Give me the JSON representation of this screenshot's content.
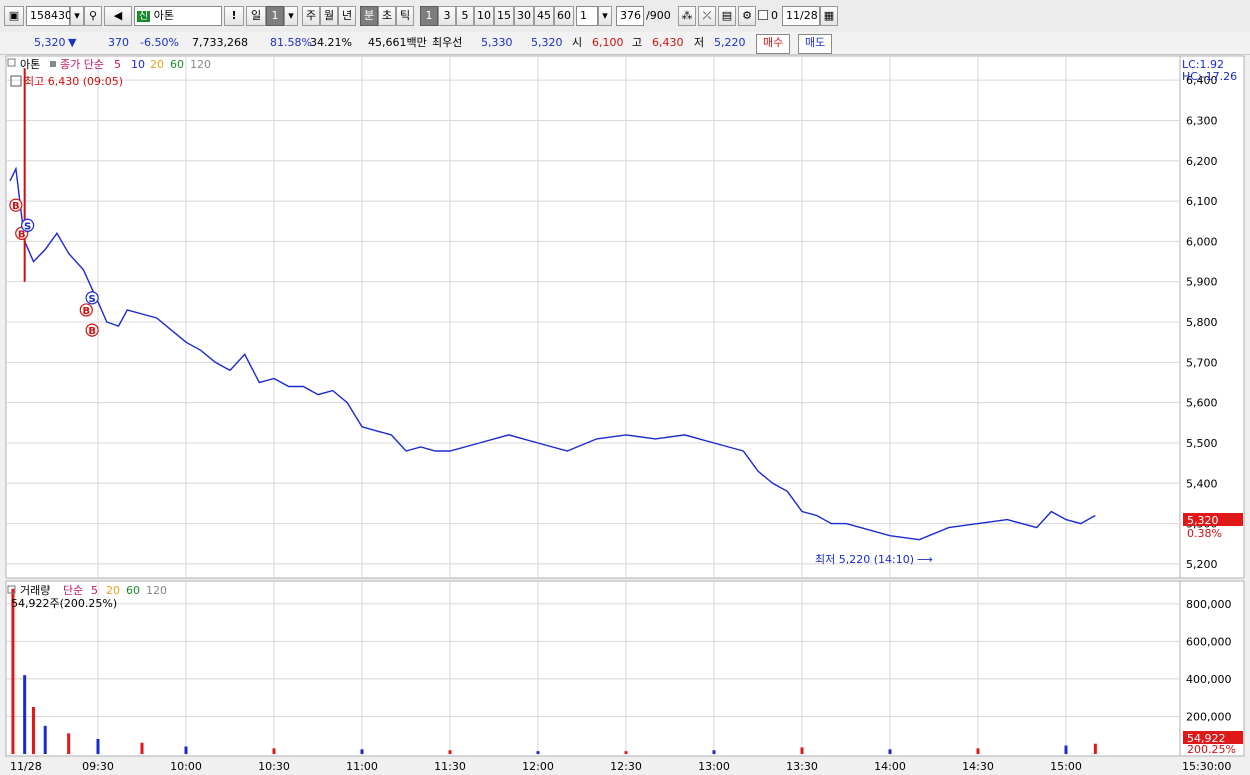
{
  "toolbar": {
    "code": "158430",
    "name": "아톤",
    "name_badge": "신",
    "exclaim": "!",
    "period_day": "일",
    "period_count": "1",
    "period_week": "주",
    "period_month": "월",
    "period_year": "년",
    "period_min": "분",
    "period_sec": "초",
    "period_tick": "틱",
    "intervals": [
      "1",
      "3",
      "5",
      "10",
      "15",
      "30",
      "45",
      "60"
    ],
    "custom_interval": "1",
    "count_shown": "376",
    "count_total": "/900",
    "checkbox_label": "0",
    "date": "11/28"
  },
  "summary": {
    "price": "5,320",
    "arrow": "▼",
    "change": "370",
    "change_pct": "-6.50%",
    "volume": "7,733,268",
    "vol_ratio": "81.58%",
    "turnover": "34.21%",
    "amount": "45,661백만",
    "best_label": "최우선",
    "best_ask": "5,330",
    "best_bid": "5,320",
    "open_label": "시",
    "open": "6,100",
    "high_label": "고",
    "high": "6,430",
    "low_label": "저",
    "low": "5,220",
    "buy_button": "매수",
    "sell_button": "매도"
  },
  "chart_data": {
    "type": "candlestick",
    "price_panel": {
      "legend_name": "아톤",
      "legend_ma": "종가 단순",
      "ma_periods": [
        "5",
        "10",
        "20",
        "60",
        "120"
      ],
      "ma_colors": [
        "#1a2ad0",
        "#d4106a",
        "#e6a214",
        "#1a8a2a",
        "#8a8a8a"
      ],
      "high_note": "최고 6,430 (09:05)",
      "low_note": "최저 5,220 (14:10)",
      "lc_label": "LC:1.92",
      "hc_label": "HC:-17.26",
      "current_price": "5,320",
      "current_pct": "0.38%",
      "ylim": [
        5170,
        6450
      ],
      "y_ticks": [
        "5,200",
        "5,300",
        "5,400",
        "5,500",
        "5,600",
        "5,700",
        "5,800",
        "5,900",
        "6,000",
        "6,100",
        "6,200",
        "6,300",
        "6,400"
      ],
      "y_tick_values": [
        5200,
        5300,
        5400,
        5500,
        5600,
        5700,
        5800,
        5900,
        6000,
        6100,
        6200,
        6300,
        6400
      ],
      "close_path_time": [
        "09:00",
        "09:02",
        "09:05",
        "09:08",
        "09:12",
        "09:16",
        "09:20",
        "09:25",
        "09:30",
        "09:33",
        "09:37",
        "09:40",
        "09:45",
        "09:50",
        "09:55",
        "10:00",
        "10:05",
        "10:10",
        "10:15",
        "10:20",
        "10:25",
        "10:30",
        "10:35",
        "10:40",
        "10:45",
        "10:50",
        "10:55",
        "11:00",
        "11:05",
        "11:10",
        "11:15",
        "11:20",
        "11:25",
        "11:30",
        "11:40",
        "11:50",
        "12:00",
        "12:10",
        "12:20",
        "12:30",
        "12:40",
        "12:50",
        "13:00",
        "13:05",
        "13:10",
        "13:15",
        "13:20",
        "13:25",
        "13:30",
        "13:35",
        "13:40",
        "13:45",
        "13:50",
        "14:00",
        "14:10",
        "14:20",
        "14:30",
        "14:40",
        "14:50",
        "14:55",
        "15:00",
        "15:05",
        "15:10"
      ],
      "close_path_value": [
        6150,
        6180,
        6000,
        5950,
        5980,
        6020,
        5970,
        5930,
        5850,
        5800,
        5790,
        5830,
        5820,
        5810,
        5780,
        5750,
        5730,
        5700,
        5680,
        5720,
        5650,
        5660,
        5640,
        5640,
        5620,
        5630,
        5600,
        5540,
        5530,
        5520,
        5480,
        5490,
        5480,
        5480,
        5500,
        5520,
        5500,
        5480,
        5510,
        5520,
        5510,
        5520,
        5500,
        5490,
        5480,
        5430,
        5400,
        5380,
        5330,
        5320,
        5300,
        5300,
        5290,
        5270,
        5260,
        5290,
        5300,
        5310,
        5290,
        5330,
        5310,
        5300,
        5320
      ],
      "signals": [
        {
          "label": "B",
          "time": "09:02",
          "price": 6090
        },
        {
          "label": "B",
          "time": "09:04",
          "price": 6020
        },
        {
          "label": "S",
          "time": "09:06",
          "price": 6040
        },
        {
          "label": "B",
          "time": "09:26",
          "price": 5830
        },
        {
          "label": "S",
          "time": "09:28",
          "price": 5860
        },
        {
          "label": "B",
          "time": "09:28",
          "price": 5780
        }
      ]
    },
    "volume_panel": {
      "legend_name": "거래량",
      "legend_ma": "단순",
      "ma_periods": [
        "5",
        "20",
        "60",
        "120"
      ],
      "top_note": "54,922주(200.25%)",
      "current_volume": "54,922",
      "current_pct": "200.25%",
      "ylim": [
        0,
        900000
      ],
      "y_ticks": [
        "200,000",
        "400,000",
        "600,000",
        "800,000"
      ],
      "y_tick_values": [
        200000,
        400000,
        600000,
        800000
      ],
      "spike_time": [
        "09:01",
        "09:05",
        "09:08",
        "09:12",
        "09:20",
        "09:30",
        "09:45",
        "10:00",
        "10:30",
        "11:00",
        "11:30",
        "12:00",
        "12:30",
        "13:00",
        "13:30",
        "14:00",
        "14:30",
        "15:00",
        "15:10"
      ],
      "spike_value": [
        880000,
        420000,
        250000,
        150000,
        110000,
        80000,
        60000,
        40000,
        30000,
        25000,
        20000,
        15000,
        15000,
        20000,
        35000,
        25000,
        30000,
        45000,
        54922
      ]
    },
    "x_ticks": [
      "11/28",
      "09:30",
      "10:00",
      "10:30",
      "11:00",
      "11:30",
      "12:00",
      "12:30",
      "13:00",
      "13:30",
      "14:00",
      "14:30",
      "15:00",
      "15:30:00"
    ],
    "x_tick_values": [
      "09:00",
      "09:30",
      "10:00",
      "10:30",
      "11:00",
      "11:30",
      "12:00",
      "12:30",
      "13:00",
      "13:30",
      "14:00",
      "14:30",
      "15:00",
      "15:30"
    ]
  }
}
